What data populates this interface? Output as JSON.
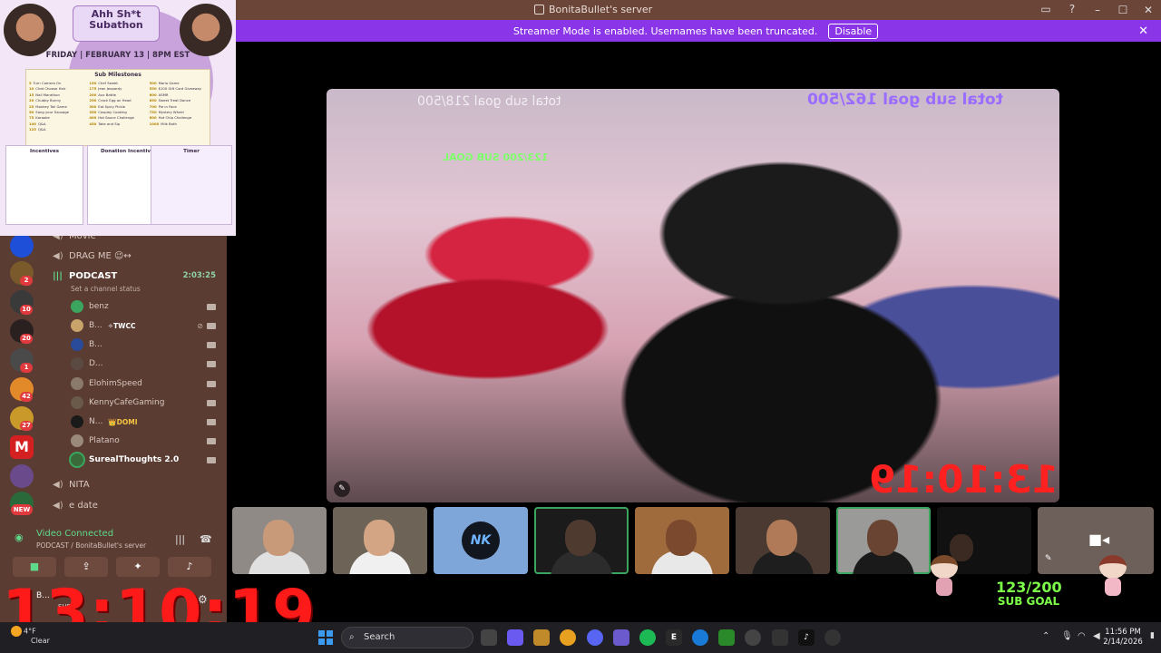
{
  "window": {
    "title": "BonitaBullet's server",
    "controls": [
      "–",
      "☐",
      "✕"
    ]
  },
  "banner": {
    "text": "Streamer Mode is enabled. Usernames have been truncated.",
    "disable_label": "Disable"
  },
  "poster": {
    "title_line1": "Ahh Sh*t",
    "title_line2": "Subathon",
    "date": "FRIDAY | FEBRUARY 13 | 8PM EST",
    "milestones_title": "Sub Milestones",
    "milestones": [
      [
        [
          "5",
          "Turn Camera On"
        ],
        [
          "10",
          "Chat Choose Hair"
        ],
        [
          "15",
          "Nail Marathon"
        ],
        [
          "20",
          "Chubby Bunny"
        ],
        [
          "25",
          "Monkey Tail Game"
        ],
        [
          "50",
          "Song your Sausage"
        ],
        [
          "75",
          "Karaoke"
        ],
        [
          "100",
          "Q&A"
        ],
        [
          "125",
          "Q&A"
        ]
      ],
      [
        [
          "150",
          "Chef Sweet"
        ],
        [
          "175",
          "Jean Jeopardy"
        ],
        [
          "200",
          "Aux Battle"
        ],
        [
          "250",
          "Crack Egg on Head"
        ],
        [
          "300",
          "Eat Spicy Pickle"
        ],
        [
          "350",
          "Cosplay Cooking"
        ],
        [
          "400",
          "Hot Sauce Challenge"
        ],
        [
          "450",
          "Take and Sip"
        ]
      ],
      [
        [
          "500",
          "Mario Game"
        ],
        [
          "550",
          "$100 Gift Card Giveaway"
        ],
        [
          "600",
          "ASMR"
        ],
        [
          "650",
          "Sweet Treat Dance"
        ],
        [
          "700",
          "Pie in Face"
        ],
        [
          "750",
          "Mystery Wheel"
        ],
        [
          "800",
          "Hot Chip Challenge"
        ],
        [
          "1000",
          "Milk Bath"
        ]
      ]
    ],
    "cards": {
      "incentives_title": "Incentives",
      "donation_title": "Donation Incentives",
      "timer_title": "Timer"
    }
  },
  "guild_badges": [
    "2",
    "10",
    "20",
    "1",
    "42",
    "27"
  ],
  "new_badge": "NEW",
  "channels": {
    "top_partial": "Movie",
    "drag_me": "DRAG ME 😉↔",
    "podcast": "PODCAST",
    "podcast_time": "2:03:25",
    "status_placeholder": "Set a channel status",
    "members": [
      {
        "name": "benz",
        "tag": ""
      },
      {
        "name": "B...",
        "tag": "✧TWCC"
      },
      {
        "name": "B...",
        "tag": ""
      },
      {
        "name": "D...",
        "tag": ""
      },
      {
        "name": "ElohimSpeed",
        "tag": ""
      },
      {
        "name": "KennyCafeGaming",
        "tag": ""
      },
      {
        "name": "N...",
        "tag": "👑DOMI"
      },
      {
        "name": "Platano",
        "tag": ""
      },
      {
        "name": "SurealThoughts 2.0",
        "tag": ""
      }
    ],
    "nita": "NITA",
    "e_date": "e date"
  },
  "voice": {
    "title": "Video Connected",
    "subtitle": "PODCAST / BonitaBullet's server"
  },
  "user": {
    "name": "B...",
    "status": "SUB"
  },
  "overlay": {
    "big_timer": "13:10:19",
    "goal_text": "total sub goal 218/500",
    "goal_right": "total sub goal 162/500",
    "sub_goal_num": "123/200",
    "sub_goal_label": "SUB GOAL",
    "small_goal": "123/200 SUB GOAL"
  },
  "taskbar": {
    "weather_temp": "4°F",
    "weather_desc": "Clear",
    "search_placeholder": "Search",
    "time": "11:56 PM",
    "date": "2/14/2026"
  },
  "colors": {
    "banner": "#8b35e8",
    "sidebar": "#5a3c33",
    "speaking": "#3ba55d",
    "timer": "#ff1a1a"
  }
}
